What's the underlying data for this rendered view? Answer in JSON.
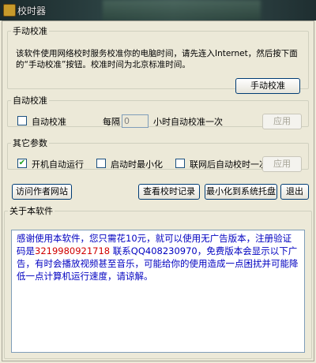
{
  "window": {
    "title": "校时器"
  },
  "manual": {
    "legend": "手动校准",
    "description": "该软件使用网络校时服务校准你的电脑时间，请先连入Internet，然后按下面的“手动校准”按钮。校准时间为北京标准时间。",
    "button": "手动校准"
  },
  "auto": {
    "legend": "自动校准",
    "checkbox_label": "自动校准",
    "interval_prefix": "每隔",
    "interval_value": "0",
    "interval_suffix": "小时自动校准一次",
    "apply": "应用"
  },
  "other": {
    "legend": "其它参数",
    "opt_startup": "开机自动运行",
    "opt_minimize": "启动时最小化",
    "opt_network": "联网后自动校时一次",
    "apply": "应用",
    "opt_startup_checked": true
  },
  "actions": {
    "visit": "访问作者网站",
    "log": "查看校时记录",
    "tray": "最小化到系统托盘",
    "exit": "退出"
  },
  "about": {
    "legend": "关于本软件",
    "text_a": "感谢使用本软件，您只需花10元，就可以使用无广告版本，注册验证码是",
    "code": "3219980921718",
    "text_b": " 联系QQ408230970，免费版本会显示以下广告，有时会播放视频甚至音乐，可能给你的使用造成一点困扰并可能降低一点计算机运行速度，请谅解。"
  },
  "colors": {
    "about_text": "#0000c0",
    "code_text": "#d00000",
    "check_mark": "#21a121"
  }
}
